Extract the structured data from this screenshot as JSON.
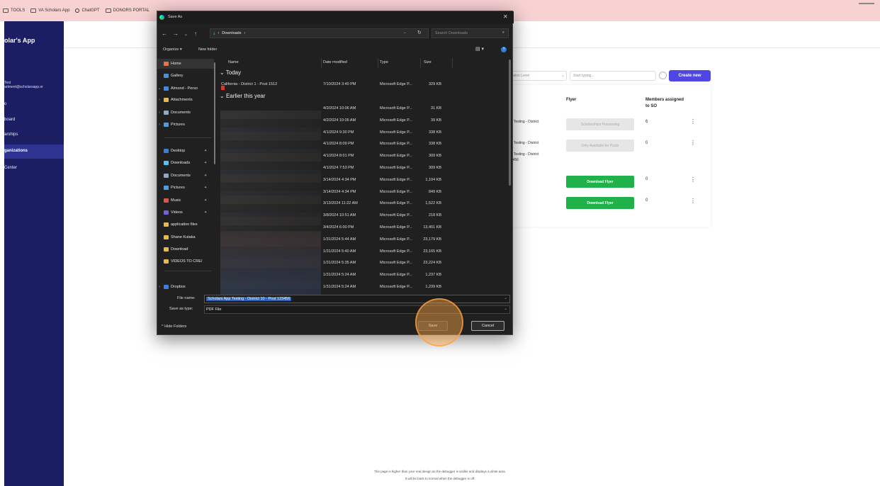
{
  "bookmarks": [
    {
      "label": "TOOLS",
      "icon": "folder-icon"
    },
    {
      "label": "VA Scholars App",
      "icon": "folder-icon"
    },
    {
      "label": "ChatGPT",
      "icon": "chatgpt-icon"
    },
    {
      "label": "DONORS PORTAL",
      "icon": "folder-icon"
    }
  ],
  "sidebar": {
    "brand": "olar's App",
    "user_name": "Test",
    "user_email": "artment@scholarsapp.or",
    "items": [
      {
        "label": "o"
      },
      {
        "label": "board"
      },
      {
        "label": "arships"
      },
      {
        "label": "ganizations"
      },
      {
        "label": "Center"
      }
    ]
  },
  "toolbar": {
    "filter_level": "ation Level",
    "search_placeholder": "Start typing...",
    "create_label": "Create new"
  },
  "table": {
    "col_flyer": "Flyer",
    "col_members": "Members assigned to SO",
    "rows": [
      {
        "name_lines": [
          "pp Testing - District"
        ],
        "flyer": "Scholarships Processing",
        "flyer_kind": "disabled",
        "members": "6"
      },
      {
        "name_lines": [
          "pp Testing - District",
          "20",
          "pp Testing - District",
          "23456"
        ],
        "flyer": "Only Available for Posts",
        "flyer_kind": "disabled",
        "members": "0"
      },
      {
        "name_lines": [],
        "flyer": "Download Flyer",
        "flyer_kind": "enabled",
        "members": "0"
      },
      {
        "name_lines": [],
        "flyer": "Download Flyer",
        "flyer_kind": "enabled",
        "members": "0"
      }
    ]
  },
  "footer": {
    "line1": "The page is higher than your real design as the debugger is visible and displays a white area.",
    "line2": "It will be back to normal when the debugger is off."
  },
  "dialog": {
    "title": "Save As",
    "address": "Downloads",
    "search_placeholder": "Search Downloads",
    "organize_label": "Organize",
    "new_folder_label": "New folder",
    "nav_tree": [
      {
        "label": "Home",
        "icon": "home-icon",
        "color": "#e8734a",
        "arrow": ""
      },
      {
        "label": "Gallery",
        "icon": "gallery-icon",
        "color": "#4a90d9",
        "arrow": ""
      },
      {
        "label": "Almond - Perso",
        "icon": "onedrive-icon",
        "color": "#3a8ee6",
        "arrow": "v"
      },
      {
        "label": "Attachments",
        "icon": "folder-icon",
        "color": "#e8b84a",
        "arrow": ">"
      },
      {
        "label": "Documents",
        "icon": "documents-icon",
        "color": "#8fa8c8",
        "arrow": ">"
      },
      {
        "label": "Pictures",
        "icon": "pictures-icon",
        "color": "#4a9fe8",
        "arrow": ">"
      },
      {
        "label": "Desktop",
        "icon": "desktop-icon",
        "color": "#3a7fd6",
        "arrow": "",
        "pin": true
      },
      {
        "label": "Downloads",
        "icon": "downloads-icon",
        "color": "#4fc3f7",
        "arrow": "",
        "pin": true
      },
      {
        "label": "Documents",
        "icon": "documents-icon",
        "color": "#8fa8c8",
        "arrow": "",
        "pin": true
      },
      {
        "label": "Pictures",
        "icon": "pictures-icon",
        "color": "#4a9fe8",
        "arrow": "",
        "pin": true
      },
      {
        "label": "Music",
        "icon": "music-icon",
        "color": "#e8504a",
        "arrow": "",
        "pin": true
      },
      {
        "label": "Videos",
        "icon": "videos-icon",
        "color": "#7a5ae8",
        "arrow": "",
        "pin": true
      },
      {
        "label": "application files",
        "icon": "folder-icon",
        "color": "#e8b84a",
        "arrow": ""
      },
      {
        "label": "Shane Kutaka",
        "icon": "folder-icon",
        "color": "#e8b84a",
        "arrow": ""
      },
      {
        "label": "Download",
        "icon": "folder-icon",
        "color": "#e8b84a",
        "arrow": ""
      },
      {
        "label": "VIDEOS TO CRE/",
        "icon": "folder-icon",
        "color": "#e8b84a",
        "arrow": ""
      },
      {
        "label": "Dropbox",
        "icon": "dropbox-icon",
        "color": "#3a7fe8",
        "arrow": ">"
      }
    ],
    "columns": {
      "name": "Name",
      "date": "Date modified",
      "type": "Type",
      "size": "Size"
    },
    "groups": {
      "today": "Today",
      "earlier": "Earlier this year"
    },
    "today_files": [
      {
        "name": "California - District 1 - Post 1512",
        "date": "7/10/2024 3:40 PM",
        "type": "Microsoft Edge P...",
        "size": "329 KB"
      }
    ],
    "earlier_files": [
      {
        "date": "4/2/2024 10:06 AM",
        "type": "Microsoft Edge P...",
        "size": "31 KB"
      },
      {
        "date": "4/2/2024 10:05 AM",
        "type": "Microsoft Edge P...",
        "size": "39 KB"
      },
      {
        "date": "4/1/2024 9:30 PM",
        "type": "Microsoft Edge P...",
        "size": "338 KB"
      },
      {
        "date": "4/1/2024 8:09 PM",
        "type": "Microsoft Edge P...",
        "size": "338 KB"
      },
      {
        "date": "4/1/2024 8:01 PM",
        "type": "Microsoft Edge P...",
        "size": "309 KB"
      },
      {
        "date": "4/1/2024 7:53 PM",
        "type": "Microsoft Edge P...",
        "size": "309 KB"
      },
      {
        "date": "3/14/2024 4:34 PM",
        "type": "Microsoft Edge P...",
        "size": "1,104 KB"
      },
      {
        "date": "3/14/2024 4:34 PM",
        "type": "Microsoft Edge P...",
        "size": "849 KB"
      },
      {
        "date": "3/13/2024 11:22 AM",
        "type": "Microsoft Edge P...",
        "size": "1,522 KB"
      },
      {
        "date": "3/8/2024 10:51 AM",
        "type": "Microsoft Edge P...",
        "size": "218 KB"
      },
      {
        "date": "3/4/2024 6:00 PM",
        "type": "Microsoft Edge P...",
        "size": "13,401 KB"
      },
      {
        "date": "1/31/2024 5:44 AM",
        "type": "Microsoft Edge P...",
        "size": "23,179 KB"
      },
      {
        "date": "1/31/2024 5:40 AM",
        "type": "Microsoft Edge P...",
        "size": "23,165 KB"
      },
      {
        "date": "1/31/2024 5:35 AM",
        "type": "Microsoft Edge P...",
        "size": "23,224 KB"
      },
      {
        "date": "1/31/2024 5:24 AM",
        "type": "Microsoft Edge P...",
        "size": "1,237 KB"
      },
      {
        "date": "1/31/2024 5:24 AM",
        "type": "Microsoft Edge P...",
        "size": "1,239 KB"
      }
    ],
    "file_name_label": "File name:",
    "file_name_value": "Scholars App Testing - District 10 - Post 123456",
    "save_type_label": "Save as type:",
    "save_type_value": "PDF File",
    "hide_folders_label": "Hide Folders",
    "save_label": "Save",
    "cancel_label": "Cancel"
  }
}
